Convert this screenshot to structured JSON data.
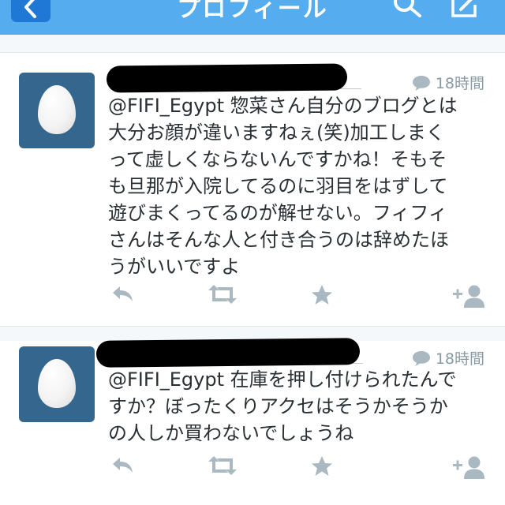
{
  "nav": {
    "title": "プロフィール",
    "back_icon": "chevron-left-icon",
    "search_icon": "search-icon",
    "compose_icon": "compose-icon",
    "colors": {
      "bar": "#55acee",
      "back_button": "#1f78d6"
    }
  },
  "tweets": [
    {
      "author_redacted": true,
      "reply_count_icon": "reply-bubble-icon",
      "time": "18時間",
      "text_lines": [
        "@FIFI_Egypt 惣菜さん自分のブログとは",
        "大分お顔が違いますねぇ(笑)加工しまく",
        "って虚しくならないんですかね！そもそ",
        "も旦那が入院してるのに羽目をはずして",
        "遊びまくってるのが解せない。フィフィ",
        "さんはそんな人と付き合うのは辞めたほ",
        "うがいいですよ"
      ]
    },
    {
      "author_redacted": true,
      "reply_count_icon": "reply-bubble-icon",
      "time": "18時間",
      "text_lines": [
        "@FIFI_Egypt 在庫を押し付けられたんで",
        "すか？ぼったくりアクセはそうかそうか",
        "の人しか買わないでしょうね"
      ]
    }
  ],
  "action_icons": [
    "reply-icon",
    "retweet-icon",
    "favorite-star-icon",
    "follow-icon"
  ],
  "colors": {
    "avatar_bg": "#35678e",
    "meta_text": "#8899a6",
    "action_icon": "#aab8c2",
    "tweet_text": "#292f33"
  }
}
